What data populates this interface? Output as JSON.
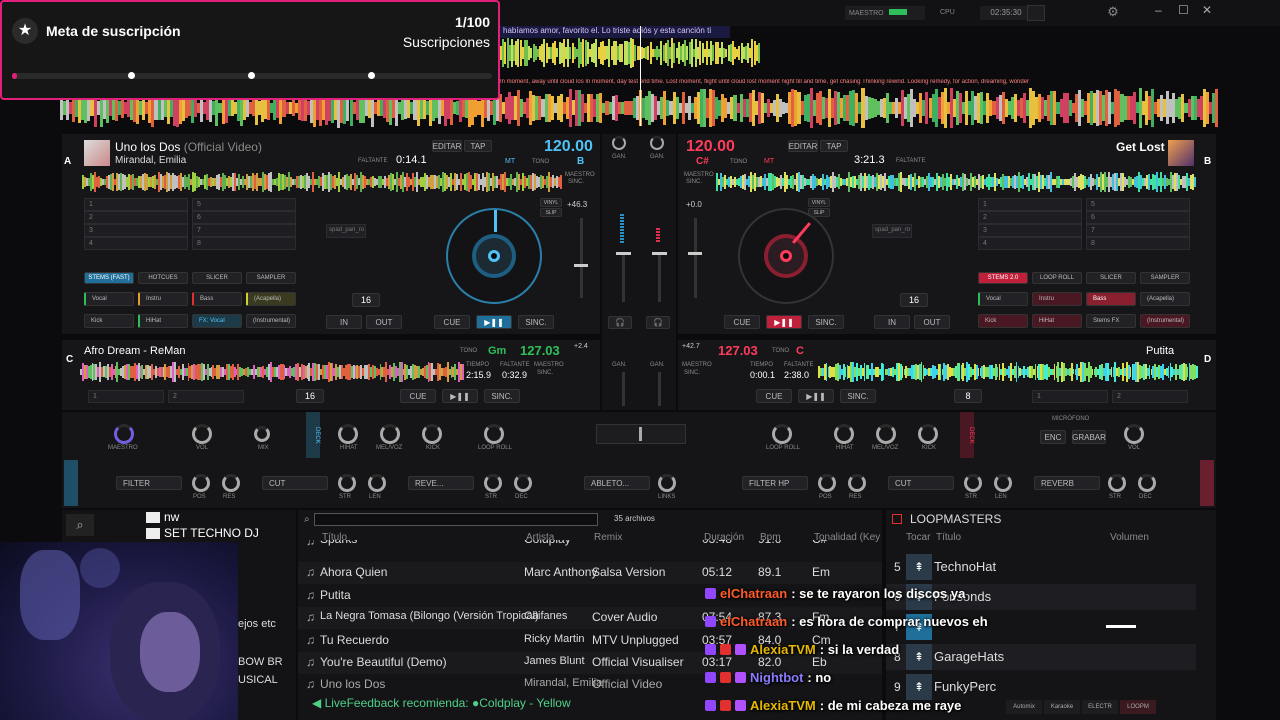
{
  "overlay": {
    "goal_title": "Meta de suscripción",
    "goal_count": "1/100",
    "goal_label": "Suscripciones"
  },
  "topbar": {
    "master_label": "MAESTRO",
    "cpu_label": "CPU",
    "clock": "02:35:30",
    "lyrics_top": "habíamos amor, favorito el. Lo triste adiós y esta canción ti",
    "lyrics_bottom": "In moment, away until cloud los  In moment, day test end time. Lost moment, flight until cloud lost  moment night till and time, get chasing   Thinking rewind. Looking remedy, for action, dreaming, wonder"
  },
  "deck_a": {
    "letter": "A",
    "title": "Uno los Dos",
    "title_suffix": "(Official Video)",
    "artist": "Mirandal, Emilia",
    "remaining_label": "FALTANTE",
    "remaining": "0:14.1",
    "edit_label": "EDITAR",
    "tap_label": "TAP",
    "bpm": "120.00",
    "key": "B",
    "tone_label": "TONO",
    "mt_label": "MT",
    "master_label": "MAESTRO",
    "sync_label": "SINC.",
    "pitch": "+46.3",
    "vinyl": "VINYL",
    "slip": "SLIP",
    "cue": "CUE",
    "play": "▶❚❚",
    "sync": "SINC.",
    "in": "IN",
    "out": "OUT",
    "loop_size": "16",
    "hotcues": [
      "1",
      "2",
      "3",
      "4",
      "5",
      "6",
      "7",
      "8"
    ],
    "tabs": [
      "STEMS (FAST)",
      "HOTCUES",
      "SLICER",
      "SAMPLER"
    ],
    "stems": [
      "Vocal",
      "Instru",
      "Bass",
      "(Acapella)",
      "Kick",
      "HiHat",
      "FX: Vocal",
      "(Instrumental)"
    ],
    "sampler_name": "spad_pan_ro"
  },
  "deck_b": {
    "letter": "B",
    "title": "Get Lost",
    "remaining": "3:21.3",
    "remaining_label": "FALTANTE",
    "edit_label": "EDITAR",
    "tap_label": "TAP",
    "bpm": "120.00",
    "key": "C#",
    "tone_label": "TONO",
    "mt_label": "MT",
    "master_label": "MAESTRO",
    "sync_label": "SINC.",
    "pitch": "+0.0",
    "vinyl": "VINYL",
    "slip": "SLIP",
    "cue": "CUE",
    "play": "▶❚❚",
    "sync": "SINC.",
    "in": "IN",
    "out": "OUT",
    "loop_size": "16",
    "hotcues": [
      "1",
      "2",
      "3",
      "4",
      "5",
      "6",
      "7",
      "8"
    ],
    "tabs": [
      "STEMS 2.0",
      "LOOP ROLL",
      "SLICER",
      "SAMPLER"
    ],
    "stems": [
      "Vocal",
      "Instru",
      "Bass",
      "(Acapella)",
      "Kick",
      "HiHat",
      "Stems FX",
      "(Instrumental)"
    ],
    "sampler_name": "spad_pan_ro"
  },
  "deck_c": {
    "letter": "C",
    "title": "Afro Dream - ReMan",
    "bpm": "127.03",
    "key": "Gm",
    "tone_label": "TONO",
    "time_label": "TIEMPO",
    "remaining_label": "FALTANTE",
    "elapsed": "2:15.9",
    "remaining": "0:32.9",
    "pitch": "+2.4",
    "loop_size": "16",
    "cue": "CUE",
    "play": "▶❚❚",
    "sync": "SINC.",
    "master_label": "MAESTRO",
    "sync_label": "SINC.",
    "hotcue_1": "1",
    "hotcue_2": "2"
  },
  "deck_d": {
    "letter": "D",
    "title": "Putita",
    "bpm": "127.03",
    "key": "C",
    "tone_label": "TONO",
    "time_label": "TIEMPO",
    "remaining_label": "FALTANTE",
    "elapsed": "0:00.1",
    "remaining": "2:38.0",
    "pitch": "+42.7",
    "loop_size": "8",
    "cue": "CUE",
    "play": "▶❚❚",
    "sync": "SINC.",
    "master_label": "MAESTRO",
    "sync_label": "SINC.",
    "hotcue_1": "1",
    "hotcue_2": "2"
  },
  "mixer": {
    "gain": "GAN.",
    "master": "MAESTRO",
    "vol": "VOL",
    "mix": "MIX",
    "hihat": "HIHAT",
    "melvoz": "MEL/VOZ",
    "kick": "KICK",
    "loop_roll": "LOOP ROLL",
    "microphone": "MICRÓFONO",
    "mic_on": "ENC",
    "record": "GRABAR",
    "deck_label": "DECK",
    "fx_left": [
      "FILTER",
      "CUT",
      "REVE..."
    ],
    "fx_center": "ABLETO...",
    "fx_right": [
      "FILTER HP",
      "CUT",
      "REVERB"
    ],
    "fx_knobs": [
      "POS",
      "RES",
      "STR",
      "LEN",
      "STR",
      "DEC"
    ],
    "links": "LINKS"
  },
  "browser": {
    "file_count": "35 archivos",
    "folders": [
      "nw",
      "SET TECHNO DJ"
    ],
    "partial_items": [
      "ejos etc",
      "BOW BR",
      "USICAL"
    ],
    "columns": [
      "Título",
      "Artista",
      "Remix",
      "Duración",
      "Bpm",
      "Tonalidad (Key"
    ],
    "rows": [
      {
        "title": "Sparks",
        "artist": "Coldplay",
        "remix": "",
        "duration": "03:48",
        "bpm": "91.6",
        "key": "C#"
      },
      {
        "title": "Ahora Quien",
        "artist": "Marc Anthony",
        "remix": "Salsa Version",
        "duration": "05:12",
        "bpm": "89.1",
        "key": "Em"
      },
      {
        "title": "Putita",
        "artist": "",
        "remix": "",
        "duration": "",
        "bpm": "",
        "key": ""
      },
      {
        "title": "La Negra Tomasa (Bilongo (Versión Tropical)",
        "artist": "Caifanes",
        "remix": "Cover Audio",
        "duration": "07:54",
        "bpm": "87.3",
        "key": "Fm"
      },
      {
        "title": "Tu Recuerdo",
        "artist": "Ricky Martin",
        "remix": "MTV Unplugged",
        "duration": "03:57",
        "bpm": "84.0",
        "key": "Cm"
      },
      {
        "title": "You're Beautiful (Demo)",
        "artist": "James Blunt",
        "remix": "Official Visualiser",
        "duration": "03:17",
        "bpm": "82.0",
        "key": "Eb"
      },
      {
        "title": "Uno los Dos",
        "artist": "Mirandal, Emilia",
        "remix": "Official Video",
        "duration": "",
        "bpm": "",
        "key": ""
      }
    ],
    "live_feedback": "LiveFeedback recomienda: ●Coldplay - Yellow"
  },
  "sampler_panel": {
    "title": "LOOPMASTERS",
    "col_play": "Tocar",
    "col_title": "Título",
    "col_volume": "Volumen",
    "items": [
      {
        "num": "5",
        "name": "TechnoHat"
      },
      {
        "num": "6",
        "name": "Fonsonds"
      },
      {
        "num": "7",
        "name": ""
      },
      {
        "num": "8",
        "name": "GarageHats"
      },
      {
        "num": "9",
        "name": "FunkyPerc"
      }
    ],
    "bottom_tabs": [
      "Automix",
      "Karaoke",
      "ELECTR",
      "LOOPM"
    ]
  },
  "chat": [
    {
      "user": "elChatraan",
      "color": "#ff5a2a",
      "text": ": se te rayaron los discos ya"
    },
    {
      "user": "elChatraan",
      "color": "#ff5a2a",
      "text": ": es hora de comprar nuevos eh"
    },
    {
      "user": "AlexiaTVM",
      "color": "#e6b800",
      "text": ": si la verdad"
    },
    {
      "user": "Nightbot",
      "color": "#8a7cff",
      "text": ": no"
    },
    {
      "user": "AlexiaTVM",
      "color": "#e6b800",
      "text": ": de mi cabeza me raye"
    }
  ]
}
